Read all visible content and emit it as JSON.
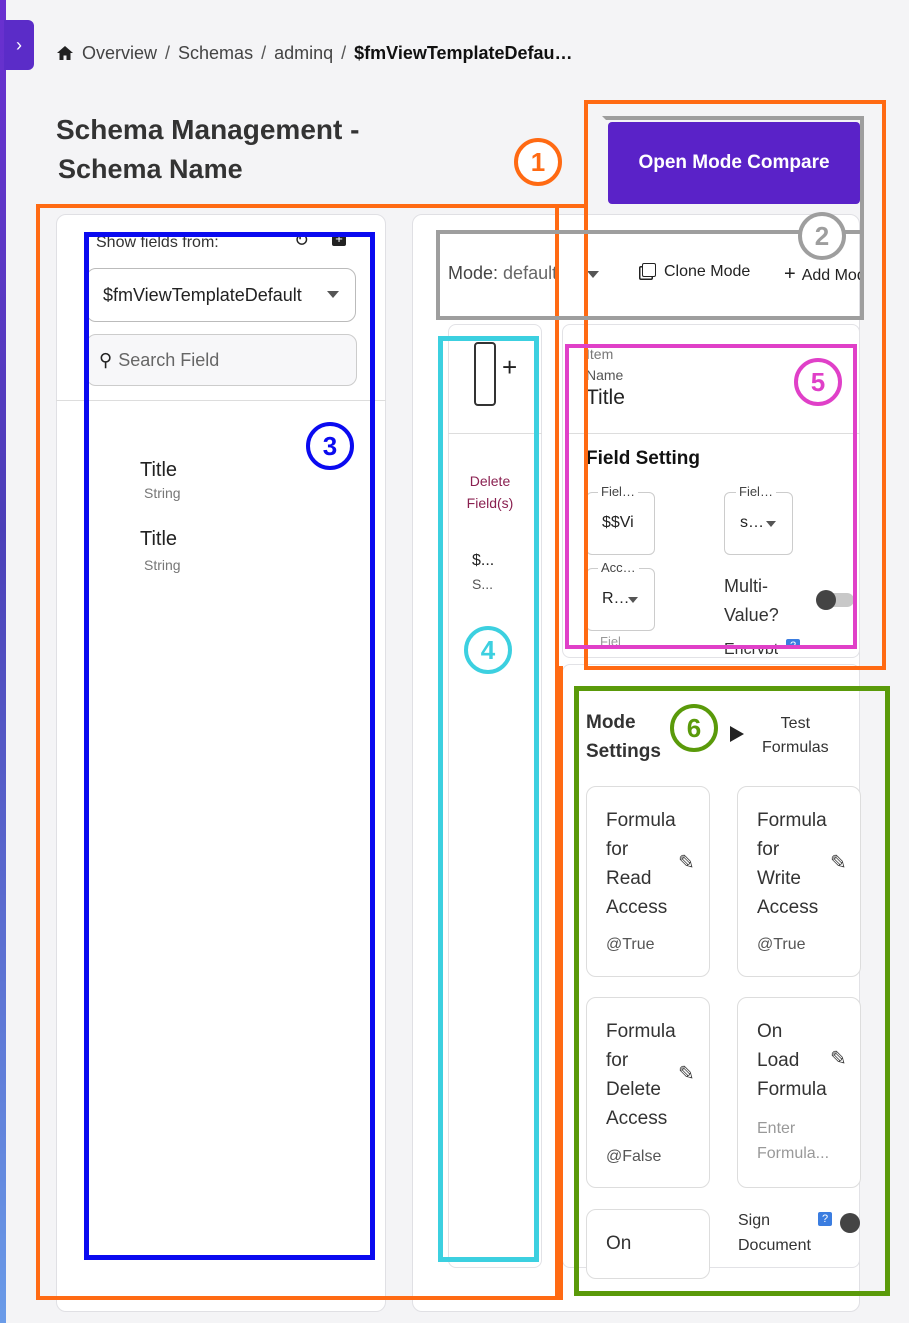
{
  "breadcrumb": {
    "home": "Overview",
    "items": [
      "Schemas",
      "adminq"
    ],
    "current": "$fmViewTemplateDefau…"
  },
  "page": {
    "title_line1": "Schema Management -",
    "title_line2": "Schema Name",
    "compare_button": "Open Mode Compare"
  },
  "left_panel": {
    "show_fields_label": "Show fields from:",
    "selected_schema": "$fmViewTemplateDefault",
    "search_placeholder": "Search Field",
    "fields": [
      {
        "name": "Title",
        "type": "String"
      },
      {
        "name": "Title",
        "type": "String"
      }
    ]
  },
  "mode_bar": {
    "mode_label": "Mode:",
    "mode_value": "default",
    "clone_label": "Clone Mode",
    "add_label": "Add Mode"
  },
  "fields_column": {
    "delete_label_1": "Delete",
    "delete_label_2": "Field(s)",
    "entry_name": "$...",
    "entry_type": "S..."
  },
  "item_card": {
    "item_label": "Item",
    "name_label": "Name",
    "name_value": "Title",
    "field_setting_title": "Field Setting",
    "field1_label": "Fiel…",
    "field1_value": "$$Vi",
    "field2_label": "Fiel…",
    "field2_value": "s…",
    "access_label": "Acc…",
    "access_value": "R…",
    "multi_value_line1": "Multi-",
    "multi_value_line2": "Value?",
    "cut_label": "Fiel",
    "encrypt_label": "Encrypt"
  },
  "mode_settings": {
    "title_line1": "Mode",
    "title_line2": "Settings",
    "test_line1": "Test",
    "test_line2": "Formulas",
    "cards": [
      {
        "lines": [
          "Formula",
          "for",
          "Read",
          "Access"
        ],
        "value": "@True"
      },
      {
        "lines": [
          "Formula",
          "for",
          "Write",
          "Access"
        ],
        "value": "@True"
      },
      {
        "lines": [
          "Formula",
          "for",
          "Delete",
          "Access"
        ],
        "value": "@False"
      },
      {
        "lines": [
          "On",
          "Load",
          "Formula"
        ],
        "placeholder_line1": "Enter",
        "placeholder_line2": "Formula..."
      }
    ],
    "partial_card_text": "On",
    "sign_line1": "Sign",
    "sign_line2": "Document"
  },
  "annotations": {
    "labels": [
      "1",
      "2",
      "3",
      "4",
      "5",
      "6"
    ],
    "colors": {
      "1": "#ff6a13",
      "2": "#9e9e9e",
      "3": "#0a0af0",
      "4": "#3cd0e0",
      "5": "#e040c8",
      "6": "#5a9a0a"
    }
  },
  "colors": {
    "primary": "#5a22c8",
    "delete_text": "#8a2050",
    "help_badge": "#3b7de0"
  }
}
